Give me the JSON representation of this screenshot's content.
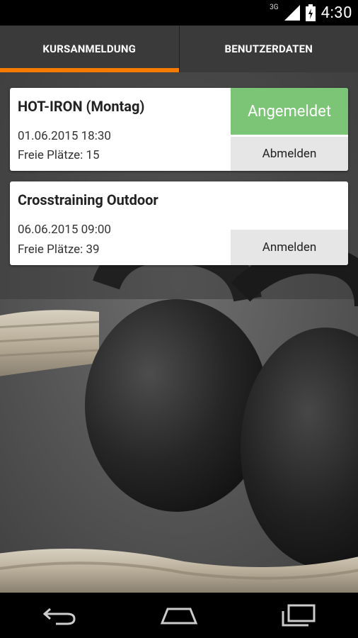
{
  "status_bar": {
    "network": "3G",
    "time": "4:30",
    "icons": [
      "signal-icon",
      "battery-icon"
    ]
  },
  "tabs": [
    {
      "label": "KURSANMELDUNG",
      "active": true
    },
    {
      "label": "BENUTZERDATEN",
      "active": false
    }
  ],
  "colors": {
    "tab_indicator": "#f57c00",
    "registered_badge": "#7cc576",
    "action_button": "#e6e6e6"
  },
  "courses": [
    {
      "title": "HOT-IRON (Montag)",
      "datetime": "01.06.2015 18:30",
      "free_slots": "Freie Plätze: 15",
      "status": "Angemeldet",
      "action": "Abmelden"
    },
    {
      "title": "Crosstraining Outdoor",
      "datetime": "06.06.2015 09:00",
      "free_slots": "Freie Plätze: 39",
      "status": "",
      "action": "Anmelden"
    }
  ],
  "nav_bar": {
    "icons": [
      "back-icon",
      "home-icon",
      "recents-icon"
    ]
  }
}
